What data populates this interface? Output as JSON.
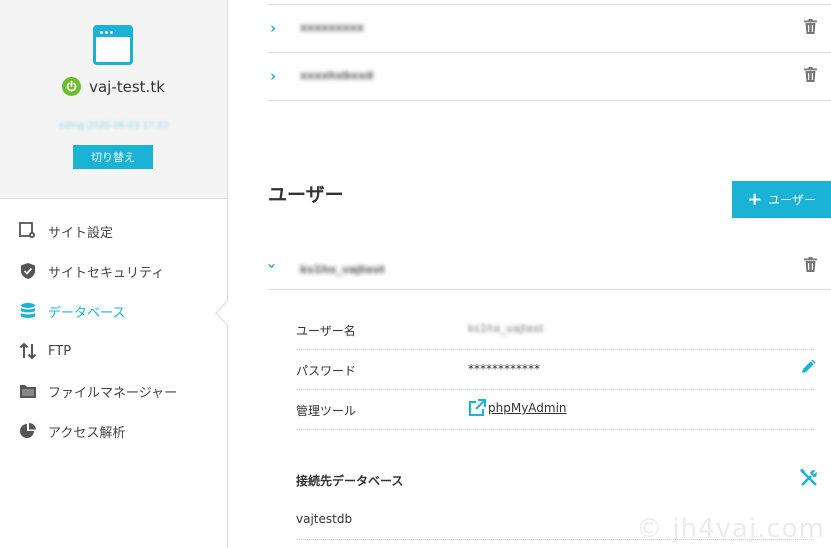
{
  "site": {
    "name": "vaj-test.tk",
    "date": "xdmg 2020-06-03 17:33",
    "switch_label": "切り替え"
  },
  "nav": [
    {
      "label": "サイト設定",
      "icon": "site-settings-icon"
    },
    {
      "label": "サイトセキュリティ",
      "icon": "shield-icon"
    },
    {
      "label": "データベース",
      "icon": "database-icon",
      "active": true
    },
    {
      "label": "FTP",
      "icon": "transfer-arrows-icon"
    },
    {
      "label": "ファイルマネージャー",
      "icon": "folder-icon"
    },
    {
      "label": "アクセス解析",
      "icon": "pie-chart-icon"
    }
  ],
  "databases": [
    {
      "name": "xxxxxxxxx"
    },
    {
      "name": "xxxxhxbxxd"
    }
  ],
  "users_section": {
    "title": "ユーザー",
    "add_button": "ユーザー"
  },
  "user": {
    "name": "ks1hx_vajtest",
    "details": [
      {
        "label": "ユーザー名",
        "value": "ks1hx_vajtest"
      },
      {
        "label": "パスワード",
        "value": "************"
      },
      {
        "label": "管理ツール",
        "value": "phpMyAdmin"
      }
    ],
    "connected_db_title": "接続先データベース",
    "connected_db": "vajtestdb"
  },
  "watermark": "© jh4vaj.com",
  "colors": {
    "accent": "#1ab3d6",
    "power": "#6cbf2c"
  }
}
